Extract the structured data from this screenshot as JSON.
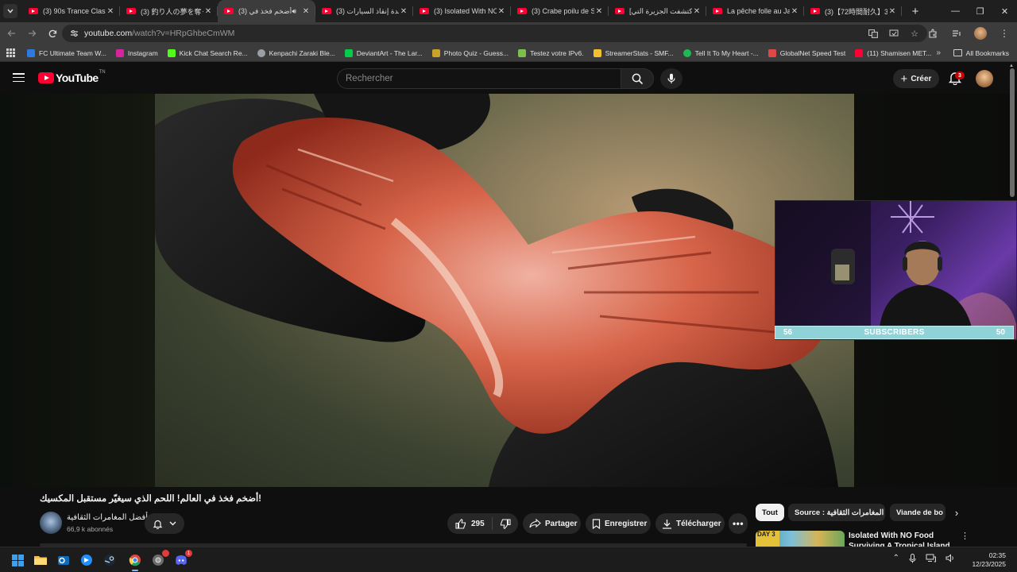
{
  "browser": {
    "tabs": [
      {
        "title": "(3) 90s Trance Classic",
        "active": false,
        "audio": false
      },
      {
        "title": "(3) 釣り人の夢を奪った",
        "active": false,
        "audio": false
      },
      {
        "title": "(3) أضخم فخذ في",
        "active": true,
        "audio": true
      },
      {
        "title": "(3) وحدة إنقاذ السيارات",
        "active": false,
        "audio": false
      },
      {
        "title": "(3) Isolated With NO",
        "active": false,
        "audio": false
      },
      {
        "title": "(3) Crabe poilu de Sa",
        "active": false,
        "audio": false
      },
      {
        "title": "[اكتشفت الجزيرة التي",
        "active": false,
        "audio": false
      },
      {
        "title": "La pêche folle au Jap",
        "active": false,
        "audio": false
      },
      {
        "title": "(3)【72時間耐久】3泊",
        "active": false,
        "audio": false
      }
    ],
    "new_tab": "+",
    "window_controls": {
      "minimize": "—",
      "maximize": "❐",
      "close": "✕"
    },
    "url_host": "youtube.com",
    "url_path": "/watch?v=HRpGhbeCmWM",
    "bookmarks": [
      {
        "label": "FC Ultimate Team W...",
        "color": "#2d7be0"
      },
      {
        "label": "Instagram",
        "color": "#d6249f"
      },
      {
        "label": "Kick Chat Search Re...",
        "color": "#53fc18"
      },
      {
        "label": "Kenpachi Zaraki Ble...",
        "color": "#9aa0a6"
      },
      {
        "label": "DeviantArt - The Lar...",
        "color": "#05cc47"
      },
      {
        "label": "Photo Quiz - Guess...",
        "color": "#c9a227"
      },
      {
        "label": "Testez votre IPv6.",
        "color": "#7cc04b"
      },
      {
        "label": "StreamerStats - SMF...",
        "color": "#f2c12e"
      },
      {
        "label": "Tell It To My Heart -...",
        "color": "#1db954"
      },
      {
        "label": "GlobalNet Speed Test",
        "color": "#e04848"
      },
      {
        "label": "(11) Shamisen MET...",
        "color": "#ff0033"
      }
    ],
    "bookmarks_more": "»",
    "all_bookmarks": "All Bookmarks"
  },
  "youtube": {
    "logo_text": "YouTube",
    "logo_sup": "TN",
    "search_placeholder": "Rechercher",
    "create_label": "Créer",
    "notification_count": "3"
  },
  "video": {
    "title": "!أضخم فخذ في العالم! اللحم الذي سيغيّر مستقبل المكسيك",
    "channel_name": "أفضل المغامرات الثقافية",
    "subscribers": "66,9 k abonnés",
    "likes": "295",
    "share_label": "Partager",
    "save_label": "Enregistrer",
    "download_label": "Télécharger",
    "more_label": "•••"
  },
  "stream_overlay": {
    "left_count": "56",
    "label": "SUBSCRIBERS",
    "right_count": "50"
  },
  "chips": [
    {
      "label": "Tout",
      "active": true
    },
    {
      "label": "Source : أفضل المغامرات الثقافية",
      "active": false
    },
    {
      "label": "Viande de bo",
      "active": false
    }
  ],
  "recommendation": {
    "badge": "DAY 3",
    "title": "Isolated With NO Food Surviving A Tropical Island"
  },
  "taskbar": {
    "time": "02:35",
    "date": "12/23/2025",
    "notification_badge": "1"
  }
}
